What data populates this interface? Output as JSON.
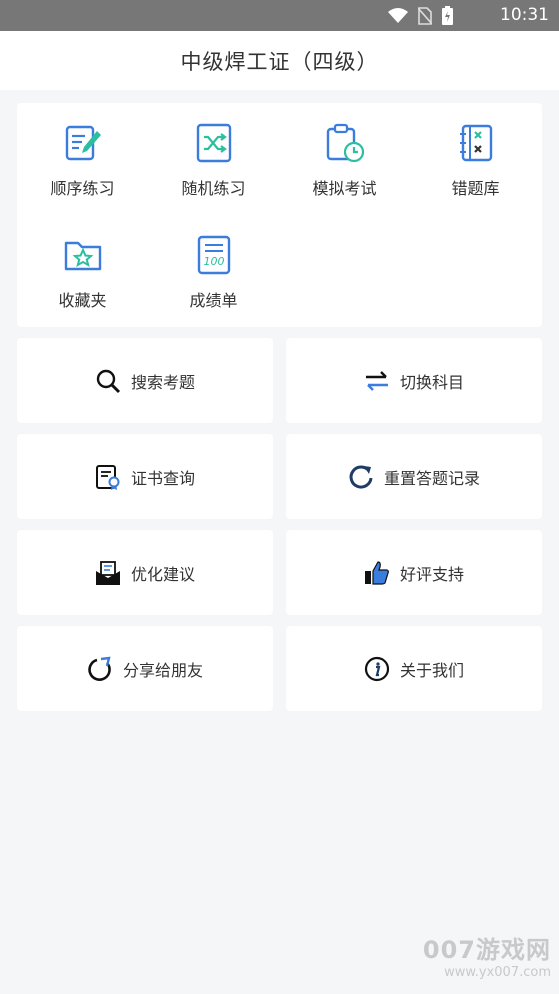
{
  "status_bar": {
    "time": "10:31",
    "icons": [
      "wifi-icon",
      "no-sim-icon",
      "battery-icon"
    ]
  },
  "header": {
    "title": "中级焊工证（四级）"
  },
  "grid": {
    "items": [
      {
        "label": "顺序练习",
        "icon": "sequential-practice-icon"
      },
      {
        "label": "随机练习",
        "icon": "shuffle-icon"
      },
      {
        "label": "模拟考试",
        "icon": "clipboard-clock-icon"
      },
      {
        "label": "错题库",
        "icon": "wrong-answers-icon"
      },
      {
        "label": "收藏夹",
        "icon": "star-folder-icon"
      },
      {
        "label": "成绩单",
        "icon": "score-sheet-icon"
      }
    ]
  },
  "tiles": [
    {
      "label": "搜索考题",
      "icon": "search-icon"
    },
    {
      "label": "切换科目",
      "icon": "swap-icon"
    },
    {
      "label": "证书查询",
      "icon": "certificate-icon"
    },
    {
      "label": "重置答题记录",
      "icon": "reset-icon"
    },
    {
      "label": "优化建议",
      "icon": "mail-icon"
    },
    {
      "label": "好评支持",
      "icon": "thumbs-up-icon"
    },
    {
      "label": "分享给朋友",
      "icon": "share-icon"
    },
    {
      "label": "关于我们",
      "icon": "info-icon"
    }
  ],
  "watermark": {
    "line1": "007游戏网",
    "line2": "www.yx007.com"
  },
  "colors": {
    "accent": "#3b7ddd",
    "green": "#2bbfa0",
    "background": "#f5f6f8"
  }
}
